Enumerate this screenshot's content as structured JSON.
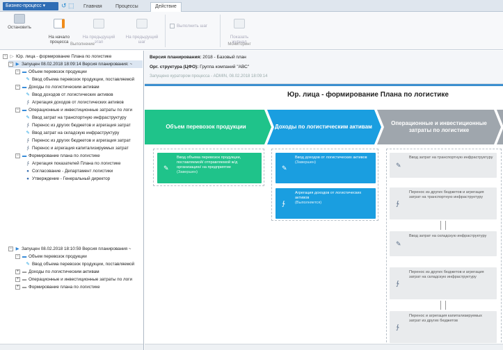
{
  "topbar": {
    "app_menu": "Бизнес-процесс ▾",
    "quick_access": "↺ ⬚",
    "tabs": [
      "Главная",
      "Процессы",
      "Действие"
    ]
  },
  "ribbon": {
    "stop": "Остановить",
    "to_start": "На начало\nпроцесса",
    "prev_stage": "На предыдущий\nэтап",
    "prev_step": "На предыдущий\nшаг",
    "do_step": "Выполнить шаг",
    "show_log": "Показать\nжурнал",
    "group_exec": "Выполнение",
    "group_mon": "Мониторинг"
  },
  "tree": {
    "root": "Юр. лица - формирование Плана по логистике",
    "run1": "Запущен 08.02.2018 18:09:14 Версия планирования: ~",
    "run1_items": [
      "Объем перевозок продукции",
      "Ввод объема перевозок продукции, поставляемой",
      "Доходы по логистическим активам",
      "Ввод доходов от логистических активов",
      "Агрегация доходов от логистических активов",
      "Операционные и инвестиционные затраты по логи",
      "Ввод затрат на транспортную инфраструктуру",
      "Перенос из других бюджетов и агрегация затрат",
      "Ввод затрат на складскую инфраструктуру",
      "Перенос из других бюджетов и агрегация затрат",
      "Перенос и агрегация капитализируемых затрат",
      "Формирование плана по логистике",
      "Агрегация показателей Плана по логистике",
      "Согласование - Департамент логистики",
      "Утверждение - Генеральный директор"
    ],
    "run2": "Запущен 08.02.2018 18:10:59 Версия планирования ~",
    "run2_items": [
      "Объем перевозок продукции",
      "Ввод объема перевозок продукции, поставляемой",
      "Доходы по логистическим активам",
      "Операционные и инвестиционные затраты по логи",
      "Формирование плана по логистике"
    ]
  },
  "info": {
    "version_label": "Версия планирования:",
    "version_value": "2018 - Базовый план",
    "org_label": "Орг. структура (ЦФО):",
    "org_value": "Группа компаний \"АВС\"",
    "launched": "Запущено куратором процесса - ADMIN, 08.02.2018 18:09:14"
  },
  "process": {
    "title": "Юр. лица - формирование Плана по логистике",
    "stages": [
      "Объем перевозок продукции",
      "Доходы по логистическим активам",
      "Операционные и инвестиционные затраты по логистике"
    ],
    "col1": [
      {
        "text": "Ввод объема перевозок продукции, поставляемой/ отправляемой ж/д организацию/ на предприятие",
        "status": "(Завершен)"
      }
    ],
    "col2": [
      {
        "text": "Ввод доходов от логистических активов",
        "status": "(Завершен)"
      },
      {
        "text": "Агрегация доходов от логистических активов",
        "status": "(Выполняется)"
      }
    ],
    "col3": [
      "Ввод затрат на транспортную инфраструктуру",
      "Перенос из других бюджетов и агрегация затрат на транспортную инфраструктуру",
      "Ввод затрат на складскую инфраструктуру",
      "Перенос из других бюджетов и агрегация затрат на складскую инфраструктуру",
      "Перенос и агрегация капитализируемых затрат из других бюджетов"
    ]
  },
  "colors": {
    "green": "#1fc38a",
    "blue": "#1a9ee0",
    "accent": "#2f6db5",
    "gray": "#9fa6ad"
  }
}
